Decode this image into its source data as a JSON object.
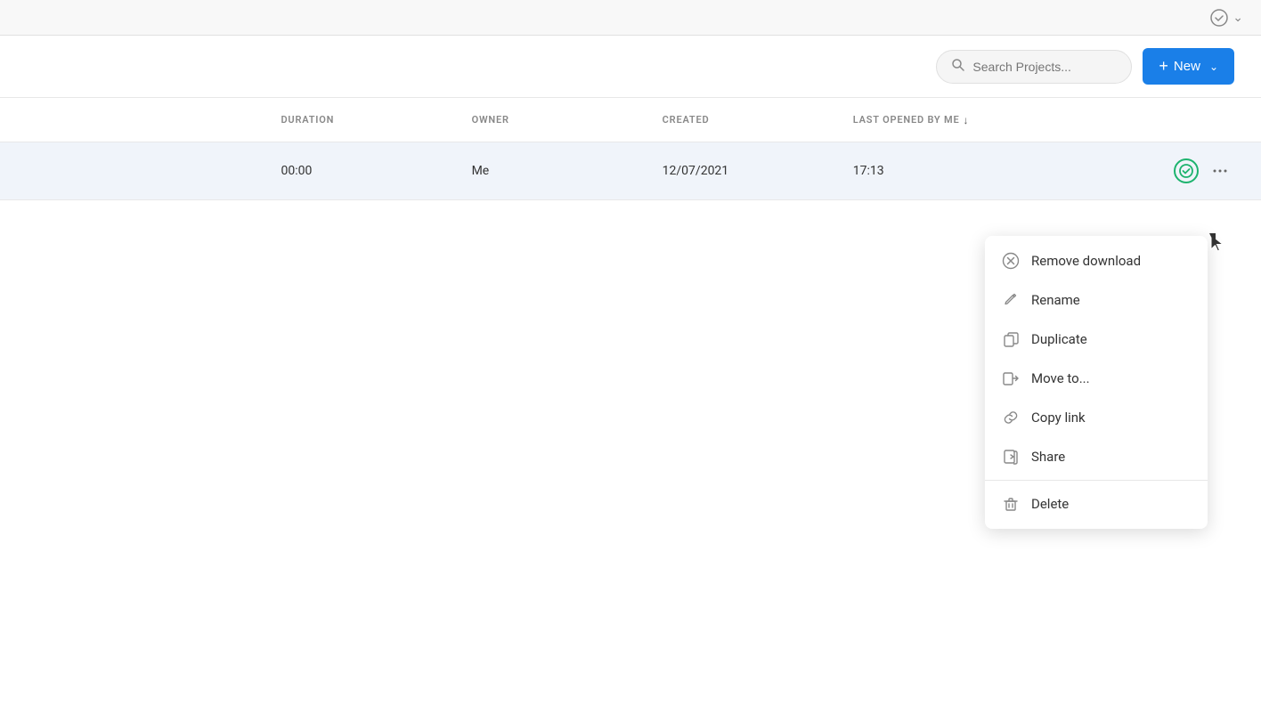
{
  "topbar": {
    "check_icon": "✓",
    "chevron_icon": "⌄"
  },
  "toolbar": {
    "search_placeholder": "Search Projects...",
    "new_button_label": "New",
    "plus_icon": "+",
    "chevron_icon": "⌄"
  },
  "table": {
    "headers": [
      {
        "id": "name",
        "label": ""
      },
      {
        "id": "duration",
        "label": "DURATION"
      },
      {
        "id": "owner",
        "label": "OWNER"
      },
      {
        "id": "created",
        "label": "CREATED"
      },
      {
        "id": "last_opened",
        "label": "LAST OPENED BY ME",
        "sort": "↓"
      },
      {
        "id": "actions",
        "label": ""
      }
    ],
    "rows": [
      {
        "name": "",
        "duration": "00:00",
        "owner": "Me",
        "created": "12/07/2021",
        "last_opened": "17:13",
        "checked": true
      }
    ]
  },
  "context_menu": {
    "items": [
      {
        "id": "remove-download",
        "label": "Remove download",
        "icon": "⊗"
      },
      {
        "id": "rename",
        "label": "Rename",
        "icon": "✎"
      },
      {
        "id": "duplicate",
        "label": "Duplicate",
        "icon": "❐"
      },
      {
        "id": "move-to",
        "label": "Move to...",
        "icon": "→"
      },
      {
        "id": "copy-link",
        "label": "Copy link",
        "icon": "🔗"
      },
      {
        "id": "share",
        "label": "Share",
        "icon": "↗"
      }
    ],
    "divider_before": [
      "delete"
    ],
    "bottom_items": [
      {
        "id": "delete",
        "label": "Delete",
        "icon": "🗑"
      }
    ]
  }
}
